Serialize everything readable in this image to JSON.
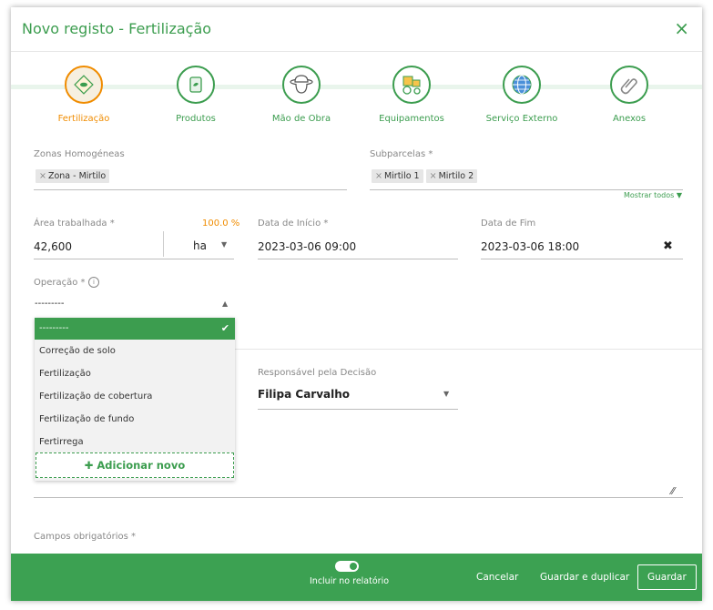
{
  "dialog": {
    "title": "Novo registo - Fertilização",
    "close_icon": "×"
  },
  "steps": [
    {
      "label": "Fertilização",
      "icon": "fertilizer-icon"
    },
    {
      "label": "Produtos",
      "icon": "product-bag-icon"
    },
    {
      "label": "Mão de Obra",
      "icon": "worker-hat-icon"
    },
    {
      "label": "Equipamentos",
      "icon": "tractor-icon"
    },
    {
      "label": "Serviço Externo",
      "icon": "globe-icon"
    },
    {
      "label": "Anexos",
      "icon": "paperclip-icon"
    }
  ],
  "zonas": {
    "label": "Zonas Homogéneas",
    "tags": [
      "Zona - Mirtilo"
    ]
  },
  "subparcelas": {
    "label": "Subparcelas *",
    "tags": [
      "Mirtilo 1",
      "Mirtilo 2"
    ],
    "show_all": "Mostrar todos ▼"
  },
  "area": {
    "label": "Área trabalhada *",
    "percent": "100.0 %",
    "value": "42,600",
    "unit": "ha"
  },
  "inicio": {
    "label": "Data de Início *",
    "value": "2023-03-06 09:00"
  },
  "fim": {
    "label": "Data de Fim",
    "value": "2023-03-06 18:00"
  },
  "operacao": {
    "label": "Operação *",
    "value": "---------",
    "options": [
      "---------",
      "Correção de solo",
      "Fertilização",
      "Fertilização de cobertura",
      "Fertilização de fundo",
      "Fertirrega"
    ],
    "add_new": "Adicionar novo"
  },
  "responsavel": {
    "label": "Responsável pela Decisão",
    "value": "Filipa Carvalho"
  },
  "required_note": "Campos obrigatórios *",
  "footer": {
    "toggle_label": "Incluir no relatório",
    "cancel": "Cancelar",
    "save_duplicate": "Guardar e duplicar",
    "save": "Guardar"
  },
  "colors": {
    "accent": "#3c9d4f",
    "active": "#f08c00"
  }
}
